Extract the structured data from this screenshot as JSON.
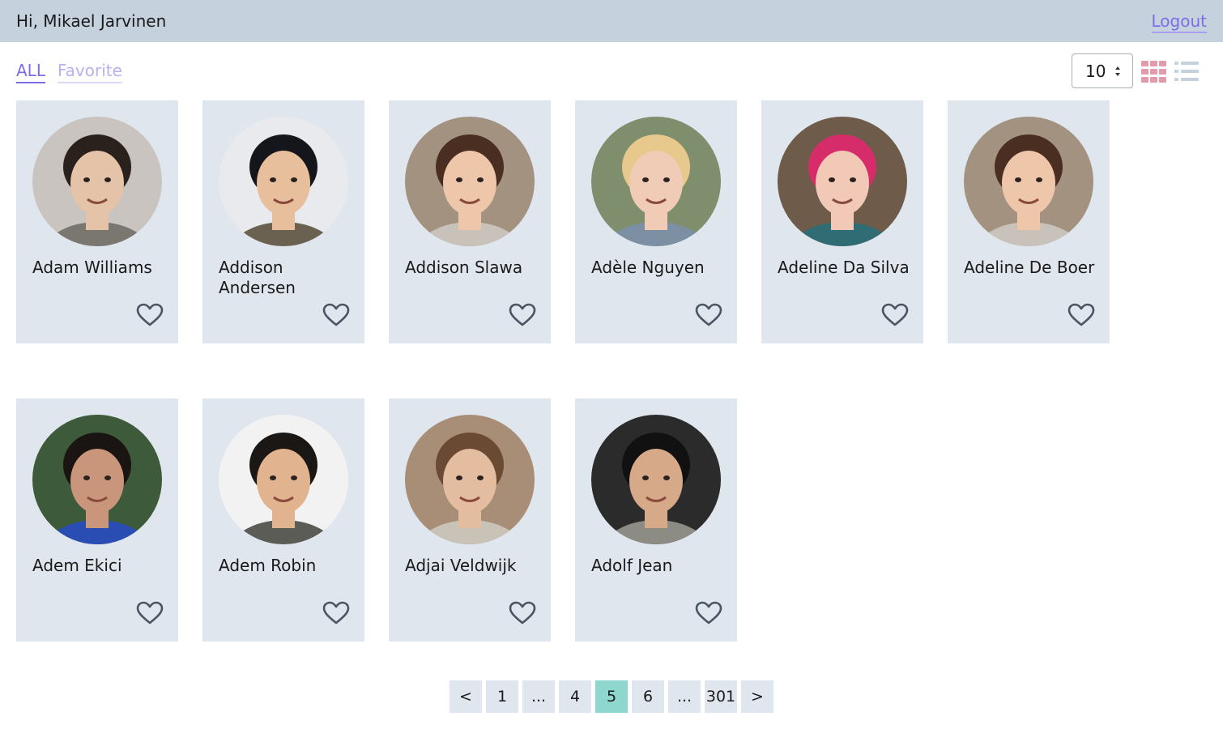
{
  "header": {
    "greeting": "Hi, Mikael Jarvinen",
    "logout_label": "Logout"
  },
  "filters": {
    "all_label": "ALL",
    "favorite_label": "Favorite"
  },
  "controls": {
    "page_size_value": "10",
    "active_view": "grid"
  },
  "colors": {
    "accent": "#7b6ee8",
    "header_bg": "#c5d1dc",
    "card_bg": "#e0e6ee",
    "current_page": "#8dd7cf",
    "grid_icon": "#e59aab"
  },
  "users": [
    {
      "name": "Adam Williams",
      "favorite": false
    },
    {
      "name": "Addison Andersen",
      "favorite": false
    },
    {
      "name": "Addison Slawa",
      "favorite": false
    },
    {
      "name": "Adèle Nguyen",
      "favorite": false
    },
    {
      "name": "Adeline Da Silva",
      "favorite": false
    },
    {
      "name": "Adeline De Boer",
      "favorite": false
    },
    {
      "name": "Adem Ekici",
      "favorite": false
    },
    {
      "name": "Adem Robin",
      "favorite": false
    },
    {
      "name": "Adjai Veldwijk",
      "favorite": false
    },
    {
      "name": "Adolf Jean",
      "favorite": false
    }
  ],
  "pagination": {
    "prev": "<",
    "next": ">",
    "pages": [
      "1",
      "...",
      "4",
      "5",
      "6",
      "...",
      "301"
    ],
    "current": "5"
  }
}
